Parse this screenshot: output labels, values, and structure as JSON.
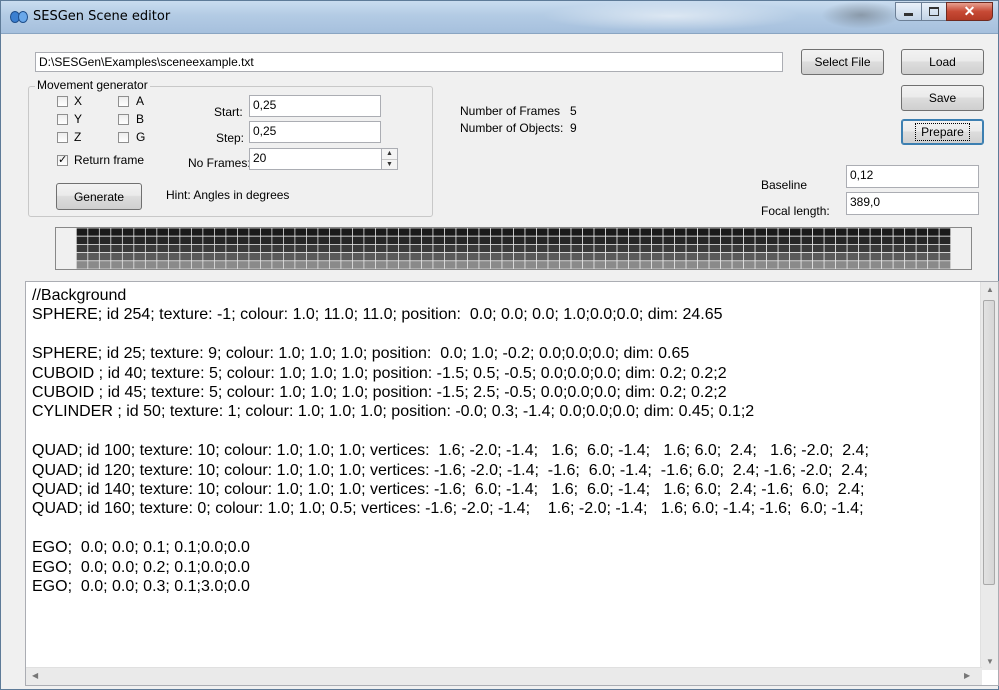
{
  "window": {
    "title": "SESGen Scene editor",
    "min_icon": "minimize-icon",
    "max_icon": "maximize-icon",
    "close_icon": "close-icon",
    "close_glyph": "✕"
  },
  "file": {
    "path": "D:\\SESGen\\Examples\\sceneexample.txt",
    "select_label": "Select File",
    "load_label": "Load",
    "save_label": "Save",
    "prepare_label": "Prepare"
  },
  "movement": {
    "group_title": "Movement generator",
    "axes": [
      {
        "label": "X",
        "checked": false
      },
      {
        "label": "Y",
        "checked": false
      },
      {
        "label": "Z",
        "checked": false
      },
      {
        "label": "A",
        "checked": false
      },
      {
        "label": "B",
        "checked": false
      },
      {
        "label": "G",
        "checked": false
      }
    ],
    "return_frame": {
      "label": "Return frame",
      "checked": true
    },
    "start_label": "Start:",
    "start_value": "0,25",
    "step_label": "Step:",
    "step_value": "0,25",
    "frames_label": "No Frames:",
    "frames_value": "20",
    "generate_label": "Generate",
    "hint": "Hint: Angles in degrees"
  },
  "stats": {
    "frames_label": "Number of Frames",
    "frames_value": "5",
    "objects_label": "Number of Objects:",
    "objects_value": "9"
  },
  "camera": {
    "baseline_label": "Baseline",
    "baseline_value": "0,12",
    "focal_label": "Focal length:",
    "focal_value": "389,0"
  },
  "editor_text": "//Background\nSPHERE; id 254; texture: -1; colour: 1.0; 11.0; 11.0; position:  0.0; 0.0; 0.0; 1.0;0.0;0.0; dim: 24.65\n\nSPHERE; id 25; texture: 9; colour: 1.0; 1.0; 1.0; position:  0.0; 1.0; -0.2; 0.0;0.0;0.0; dim: 0.65\nCUBOID ; id 40; texture: 5; colour: 1.0; 1.0; 1.0; position: -1.5; 0.5; -0.5; 0.0;0.0;0.0; dim: 0.2; 0.2;2\nCUBOID ; id 45; texture: 5; colour: 1.0; 1.0; 1.0; position: -1.5; 2.5; -0.5; 0.0;0.0;0.0; dim: 0.2; 0.2;2\nCYLINDER ; id 50; texture: 1; colour: 1.0; 1.0; 1.0; position: -0.0; 0.3; -1.4; 0.0;0.0;0.0; dim: 0.45; 0.1;2\n\nQUAD; id 100; texture: 10; colour: 1.0; 1.0; 1.0; vertices:  1.6; -2.0; -1.4;   1.6;  6.0; -1.4;   1.6; 6.0;  2.4;   1.6; -2.0;  2.4;\nQUAD; id 120; texture: 10; colour: 1.0; 1.0; 1.0; vertices: -1.6; -2.0; -1.4;  -1.6;  6.0; -1.4;  -1.6; 6.0;  2.4; -1.6; -2.0;  2.4;\nQUAD; id 140; texture: 10; colour: 1.0; 1.0; 1.0; vertices: -1.6;  6.0; -1.4;   1.6;  6.0; -1.4;   1.6; 6.0;  2.4; -1.6;  6.0;  2.4;\nQUAD; id 160; texture: 0; colour: 1.0; 1.0; 0.5; vertices: -1.6; -2.0; -1.4;    1.6; -2.0; -1.4;   1.6; 6.0; -1.4; -1.6;  6.0; -1.4;\n\nEGO;  0.0; 0.0; 0.1; 0.1;0.0;0.0\nEGO;  0.0; 0.0; 0.2; 0.1;0.0;0.0\nEGO;  0.0; 0.0; 0.3; 0.1;3.0;0.0",
  "colors": {
    "titlebar": "#b3cbe4",
    "close_button": "#c74a35",
    "window_bg": "#f0f0f0"
  }
}
